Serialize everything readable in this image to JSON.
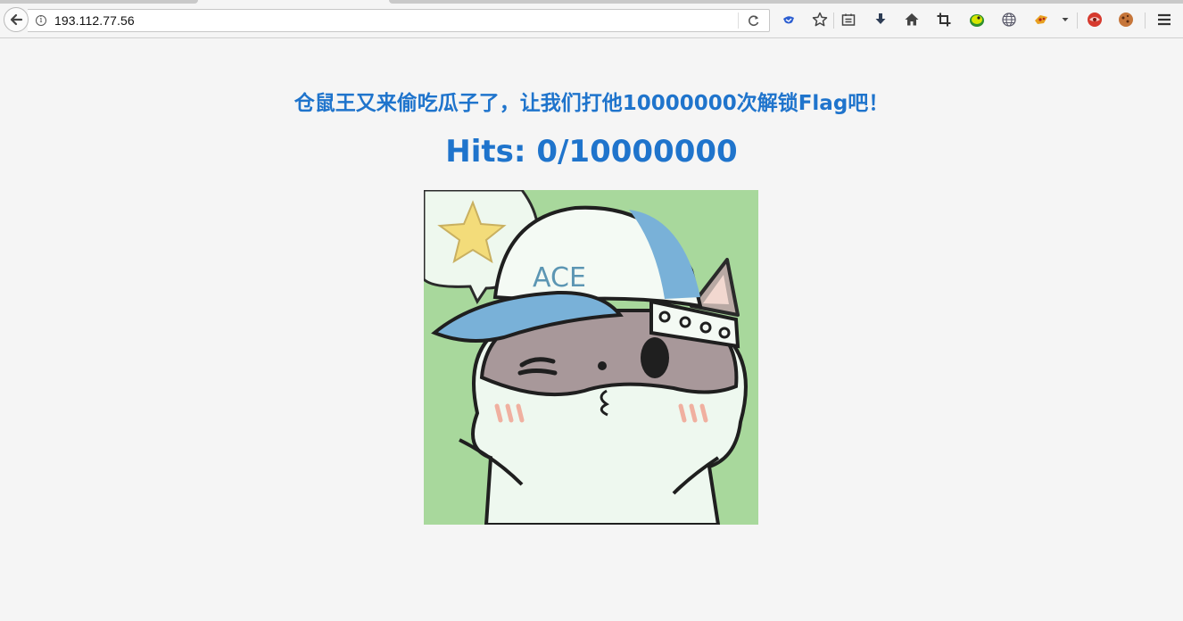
{
  "browser": {
    "url": "193.112.77.56",
    "toolbar_icons": [
      "pocket-icon",
      "bookmark-star-icon",
      "reader-list-icon",
      "download-icon",
      "home-icon",
      "crop-screenshot-icon",
      "green-extension-icon",
      "globe-icon",
      "orange-extension-icon",
      "dropdown-arrow-icon",
      "red-extension-icon",
      "cookie-extension-icon",
      "hamburger-menu-icon"
    ]
  },
  "page": {
    "headline": "仓鼠王又来偷吃瓜子了，让我们打他10000000次解锁Flag吧！",
    "hits_label": "Hits:",
    "hits_count": "0/10000000",
    "image_caption": "ACE"
  },
  "colors": {
    "text_accent": "#1f74cc",
    "page_background": "#f5f5f5",
    "image_background": "#a8d89c"
  }
}
